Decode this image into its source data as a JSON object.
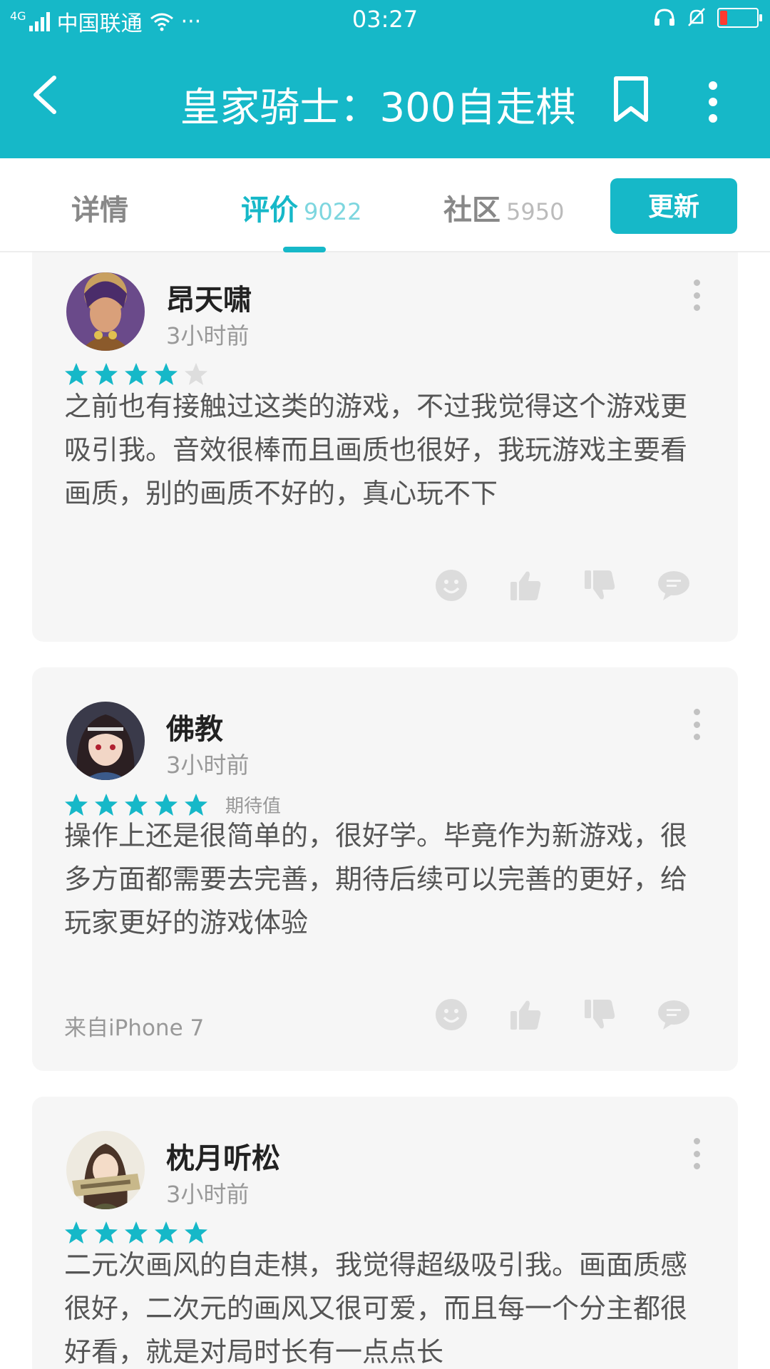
{
  "status_bar": {
    "network": "4G",
    "carrier": "中国联通",
    "extra": "···",
    "time": "03:27"
  },
  "header": {
    "title": "皇家骑士：300自走棋"
  },
  "tabs": [
    {
      "label": "详情",
      "count": ""
    },
    {
      "label": "评价",
      "count": "9022"
    },
    {
      "label": "社区",
      "count": "5950"
    }
  ],
  "active_tab": "评价",
  "update_button": "更新",
  "colors": {
    "accent": "#16b8c8",
    "star_empty": "#dddddd",
    "card_bg": "#f6f6f6"
  },
  "reviews": [
    {
      "name": "昂天啸",
      "time": "3小时前",
      "rating": 4,
      "tag": "",
      "text": "之前也有接触过这类的游戏，不过我觉得这个游戏更吸引我。音效很棒而且画质也很好，我玩游戏主要看画质，别的画质不好的，真心玩不下",
      "device": ""
    },
    {
      "name": "佛教",
      "time": "3小时前",
      "rating": 5,
      "tag": "期待值",
      "text": "操作上还是很简单的，很好学。毕竟作为新游戏，很多方面都需要去完善，期待后续可以完善的更好，给玩家更好的游戏体验",
      "device": "来自iPhone 7"
    },
    {
      "name": "枕月听松",
      "time": "3小时前",
      "rating": 5,
      "tag": "",
      "text": "二元次画风的自走棋，我觉得超级吸引我。画面质感很好，二次元的画风又很可爱，而且每一个分主都很好看，就是对局时长有一点点长",
      "device": ""
    }
  ],
  "icons": [
    "back-arrow-icon",
    "bookmark-icon",
    "more-vert-icon",
    "smiley-icon",
    "thumbs-up-icon",
    "thumbs-down-icon",
    "comment-icon"
  ]
}
